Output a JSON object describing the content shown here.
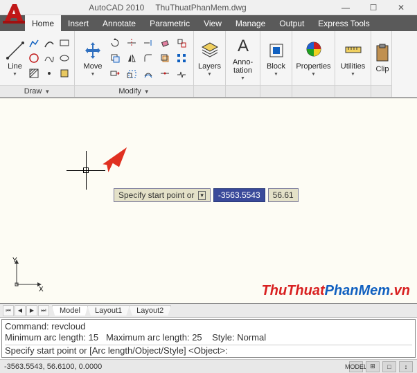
{
  "title": {
    "app": "AutoCAD 2010",
    "doc": "ThuThuatPhanMem.dwg"
  },
  "ribbon_tabs": [
    "Home",
    "Insert",
    "Annotate",
    "Parametric",
    "View",
    "Manage",
    "Output",
    "Express Tools"
  ],
  "active_tab": 0,
  "panels": {
    "draw": {
      "label": "Draw",
      "line_label": "Line"
    },
    "modify": {
      "label": "Modify",
      "move_label": "Move"
    },
    "layers": {
      "label": "Layers"
    },
    "annotation": {
      "label": "Anno-\ntation"
    },
    "block": {
      "label": "Block"
    },
    "properties": {
      "label": "Properties"
    },
    "utilities": {
      "label": "Utilities"
    },
    "clipboard": {
      "label": "Clip"
    }
  },
  "drawing": {
    "dynamic_prompt": "Specify start point or",
    "coord_x": "-3563.5543",
    "coord_y": "56.61",
    "ucs_y": "Y",
    "ucs_x": "X"
  },
  "watermark": {
    "a": "ThuThuat",
    "b": "PhanMem",
    "c": ".vn"
  },
  "layout_tabs": [
    "Model",
    "Layout1",
    "Layout2"
  ],
  "active_layout": 0,
  "command": {
    "line1": "Command: revcloud",
    "line2": "Minimum arc length: 15   Maximum arc length: 25    Style: Normal",
    "line3": "Specify start point or [Arc length/Object/Style] <Object>:"
  },
  "status": {
    "coords": "-3563.5543, 56.6100, 0.0000",
    "tray": [
      "MODEL",
      "⊞",
      "□",
      "↕"
    ]
  }
}
